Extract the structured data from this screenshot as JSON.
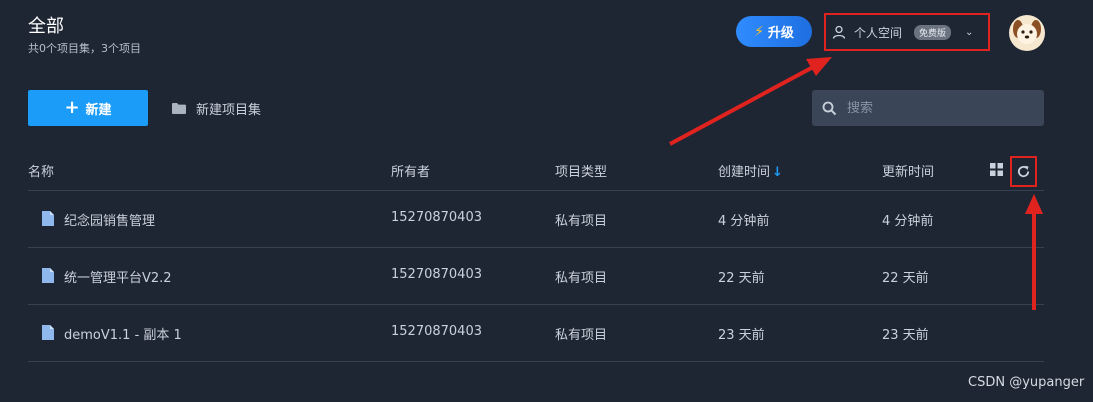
{
  "header": {
    "title": "全部",
    "subtitle": "共0个项目集，3个项目",
    "upgrade_label": "升级",
    "space_label": "个人空间",
    "plan_badge": "免费版"
  },
  "toolbar": {
    "new_label": "新建",
    "new_set_label": "新建项目集",
    "search_placeholder": "搜索"
  },
  "table": {
    "columns": [
      "名称",
      "所有者",
      "项目类型",
      "创建时间",
      "更新时间"
    ],
    "sort_indicator": "↓",
    "rows": [
      {
        "name": "纪念园销售管理",
        "owner": "15270870403",
        "type": "私有项目",
        "created": "4 分钟前",
        "updated": "4 分钟前"
      },
      {
        "name": "统一管理平台V2.2",
        "owner": "15270870403",
        "type": "私有项目",
        "created": "22 天前",
        "updated": "22 天前"
      },
      {
        "name": "demoV1.1 - 副本 1",
        "owner": "15270870403",
        "type": "私有项目",
        "created": "23 天前",
        "updated": "23 天前"
      }
    ]
  },
  "watermark": "CSDN @yupanger",
  "colors": {
    "background": "#1f2633",
    "accent": "#1b9cf8",
    "annotation_red": "#e1231f"
  },
  "icons": [
    "bolt-icon",
    "user-icon",
    "chevron-down-icon",
    "avatar-dog",
    "plus-icon",
    "folder-icon",
    "search-icon",
    "grid-view-icon",
    "refresh-icon",
    "document-icon"
  ]
}
